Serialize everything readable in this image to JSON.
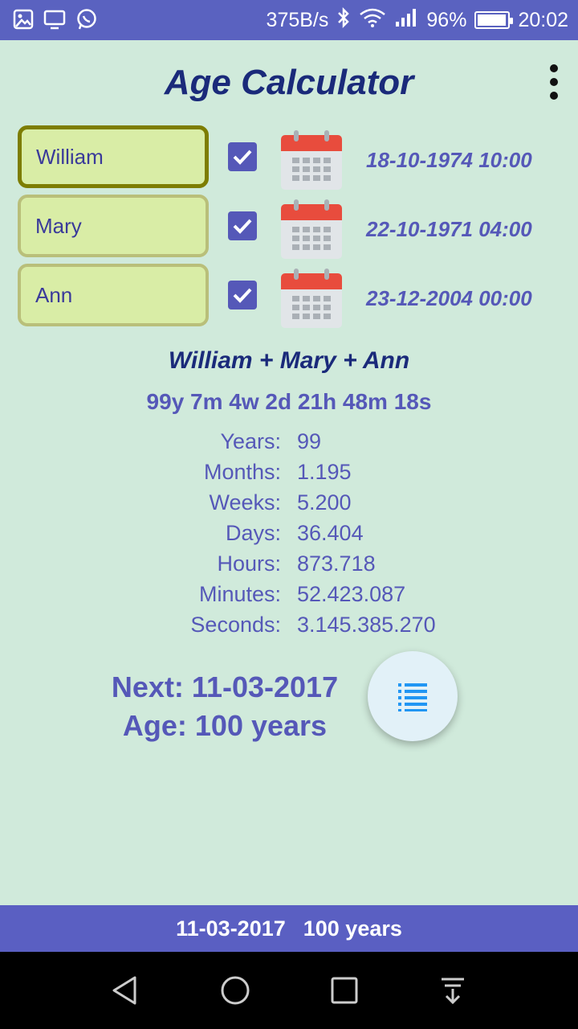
{
  "status_bar": {
    "net_speed": "375B/s",
    "battery_percent": "96%",
    "battery_level": 0.96,
    "time": "20:02",
    "left_icons": [
      "image-icon",
      "monitor-icon",
      "whatsapp-icon"
    ],
    "right_icons": [
      "bluetooth-icon",
      "wifi-icon",
      "signal-icon",
      "battery-icon"
    ]
  },
  "header": {
    "title": "Age Calculator",
    "menu_icon": "more-vert-icon"
  },
  "persons": [
    {
      "name": "William",
      "checked": true,
      "date": "18-10-1974 10:00",
      "active": true
    },
    {
      "name": "Mary",
      "checked": true,
      "date": "22-10-1971 04:00",
      "active": false
    },
    {
      "name": "Ann",
      "checked": true,
      "date": "23-12-2004 00:00",
      "active": false
    }
  ],
  "summary": {
    "names": "William + Mary + Ann",
    "age": "99y 7m 4w 2d 21h 48m 18s"
  },
  "stats": [
    {
      "label": "Years:",
      "value": "99"
    },
    {
      "label": "Months:",
      "value": "1.195"
    },
    {
      "label": "Weeks:",
      "value": "5.200"
    },
    {
      "label": "Days:",
      "value": "36.404"
    },
    {
      "label": "Hours:",
      "value": "873.718"
    },
    {
      "label": "Minutes:",
      "value": "52.423.087"
    },
    {
      "label": "Seconds:",
      "value": "3.145.385.270"
    }
  ],
  "next": {
    "date_line": "Next: 11-03-2017",
    "age_line": "Age: 100 years",
    "fab_icon": "list-icon"
  },
  "bottom_bar": {
    "date": "11-03-2017",
    "age": "100 years"
  },
  "nav": {
    "back_icon": "back-icon",
    "home_icon": "home-icon",
    "recents_icon": "recents-icon",
    "notifications_icon": "notifications-down-icon"
  },
  "colors": {
    "background": "#d0eadb",
    "status_bar": "#5a62c0",
    "title": "#1a2a7a",
    "accent": "#5558b8",
    "name_box": "#d9eda6",
    "bottom_bar": "#5a5fc2",
    "calendar_red": "#e84c3d"
  }
}
